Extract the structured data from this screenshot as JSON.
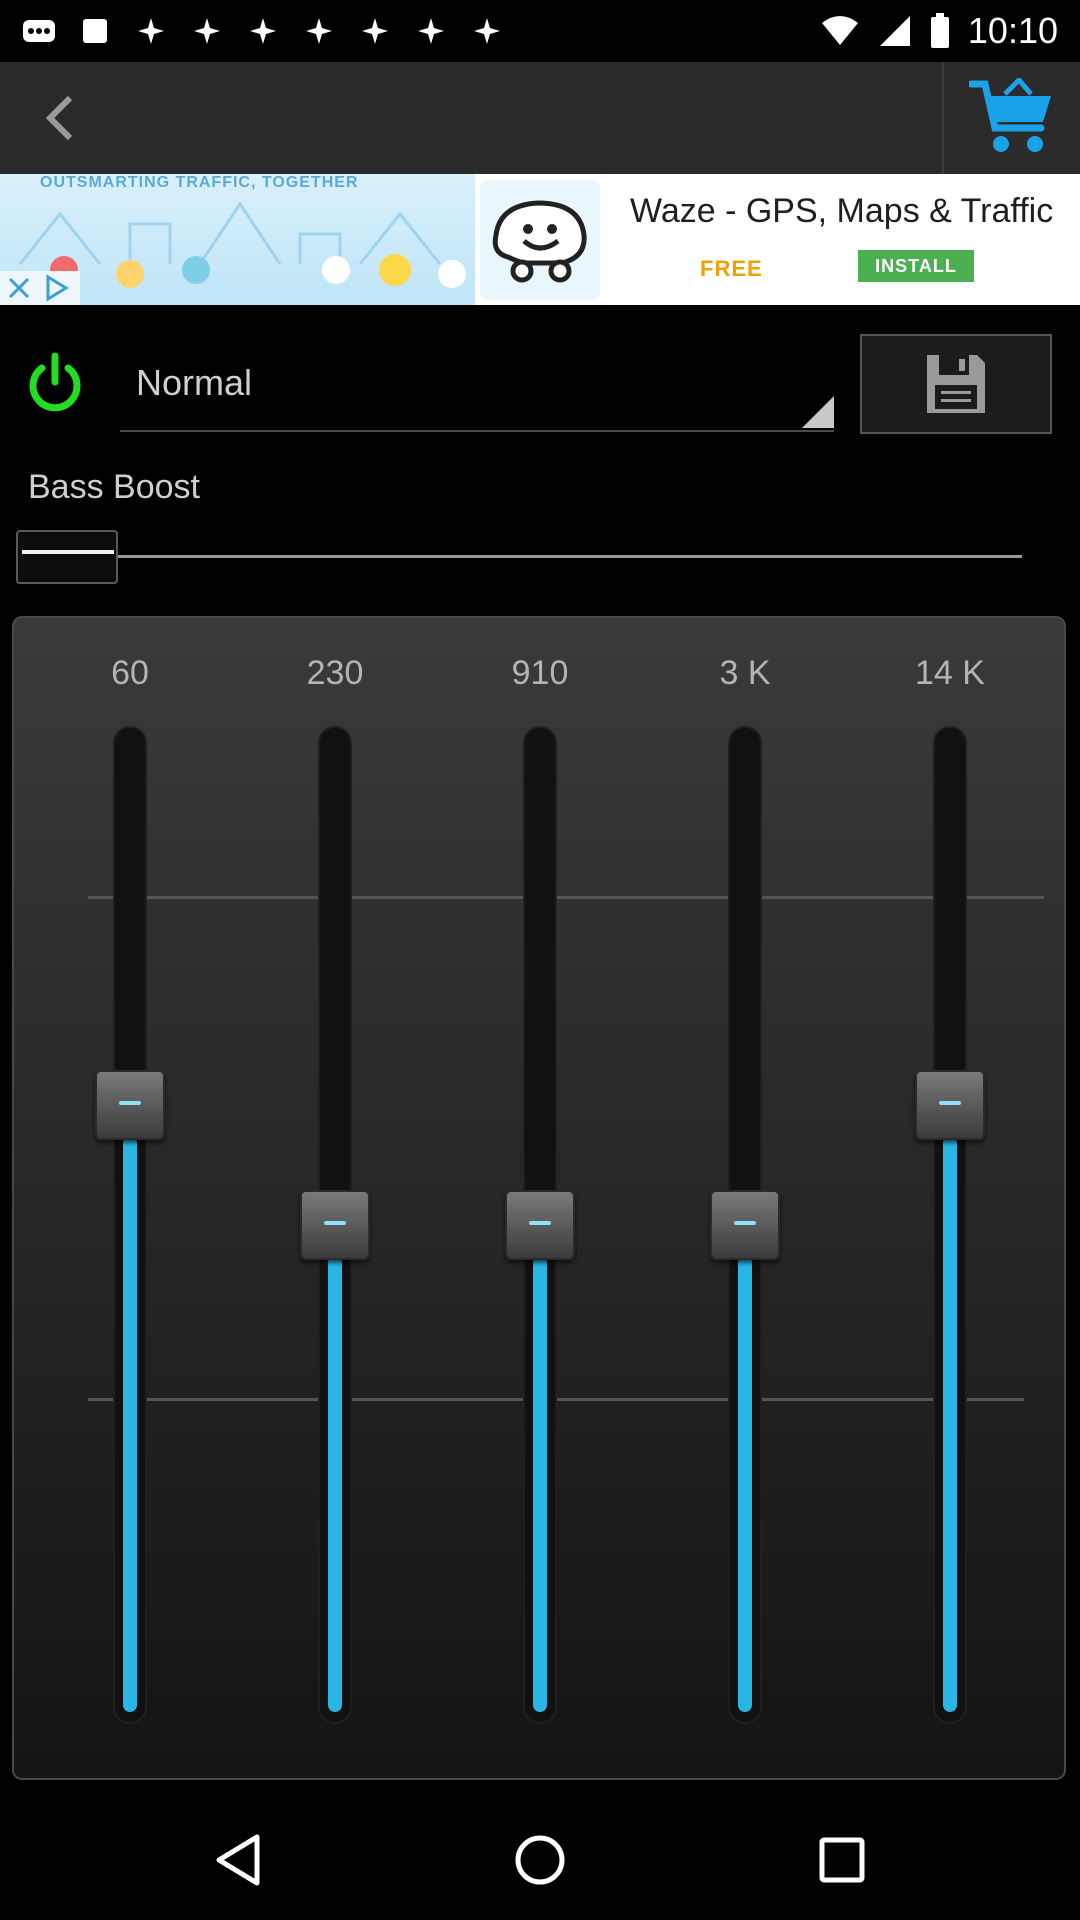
{
  "status_bar": {
    "time": "10:10",
    "notification_icons": [
      "more-icon",
      "image-icon",
      "pinwheel-icon",
      "pinwheel-icon",
      "pinwheel-icon",
      "pinwheel-icon",
      "pinwheel-icon",
      "pinwheel-icon",
      "pinwheel-icon"
    ],
    "right_icons": [
      "wifi-icon",
      "signal-icon",
      "battery-icon"
    ]
  },
  "app_bar": {
    "back_icon": "chevron-left-icon",
    "cart_icon": "shopping-cart-icon",
    "accent_color": "#1aa3e8"
  },
  "ad": {
    "tagline": "OUTSMARTING TRAFFIC, TOGETHER",
    "title": "Waze - GPS, Maps & Traffic",
    "free_label": "FREE",
    "install_label": "INSTALL"
  },
  "preset": {
    "power_icon": "power-icon",
    "selected": "Normal",
    "save_icon": "floppy-disk-icon",
    "power_color": "#22dd22"
  },
  "bass_boost": {
    "label": "Bass Boost",
    "value_fraction": 0.0
  },
  "equalizer": {
    "fill_color": "#29b6e4",
    "bands": [
      {
        "label": "60",
        "level": 0.62
      },
      {
        "label": "230",
        "level": 0.5
      },
      {
        "label": "910",
        "level": 0.5
      },
      {
        "label": "3 K",
        "level": 0.5
      },
      {
        "label": "14 K",
        "level": 0.62
      }
    ]
  },
  "nav_bar": {
    "back_icon": "triangle-back-icon",
    "home_icon": "circle-home-icon",
    "recents_icon": "square-recents-icon"
  }
}
